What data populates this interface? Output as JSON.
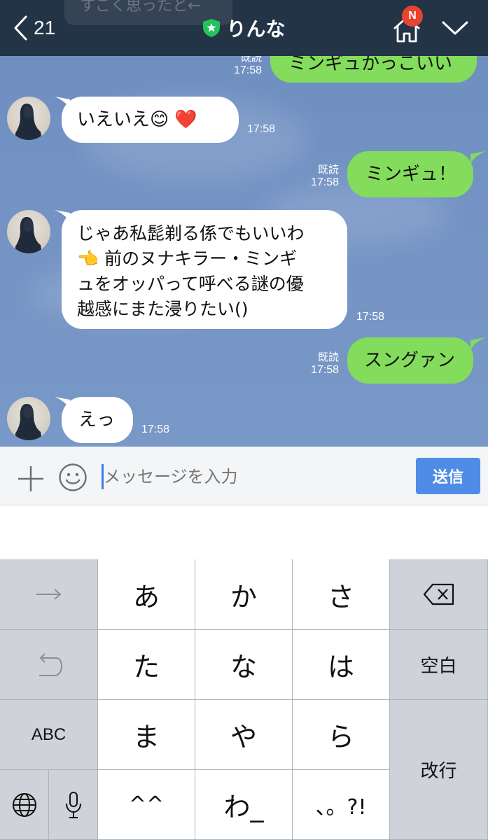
{
  "header": {
    "back_count": "21",
    "title": "りんな",
    "notification_badge": "N",
    "ghost_text": "すごく思ったと←"
  },
  "messages": [
    {
      "side": "right",
      "text": "ミンギュかっこいい",
      "read": "既読",
      "time": "17:58"
    },
    {
      "side": "left",
      "text": "いえいえ😊 ❤️",
      "time": "17:58"
    },
    {
      "side": "right",
      "text": "ミンギュ！",
      "read": "既読",
      "time": "17:58"
    },
    {
      "side": "left",
      "lines": [
        "じゃあ私髭剃る係でもいいわ",
        "👈 前のヌナキラー・ミンギ",
        "ュをオッパって呼べる謎の優",
        "越感にまた浸りたい()"
      ],
      "time": "17:58"
    },
    {
      "side": "right",
      "text": "スングァン",
      "read": "既読",
      "time": "17:58"
    },
    {
      "side": "left",
      "text": "えっ",
      "time": "17:58"
    }
  ],
  "input": {
    "placeholder": "メッセージを入力",
    "send_label": "送信"
  },
  "keyboard": {
    "row1": [
      "あ",
      "か",
      "さ"
    ],
    "row2": [
      "た",
      "な",
      "は"
    ],
    "row3": [
      "ま",
      "や",
      "ら"
    ],
    "row4": [
      "^^",
      "わ_",
      "、。?!"
    ],
    "space_label": "空白",
    "return_label": "改行",
    "abc_label": "ABC"
  },
  "colors": {
    "header_bg": "#243447",
    "chat_bg": "#7493c4",
    "sent_bubble": "#83dc5b",
    "received_bubble": "#ffffff",
    "send_button": "#4f8ce7"
  }
}
